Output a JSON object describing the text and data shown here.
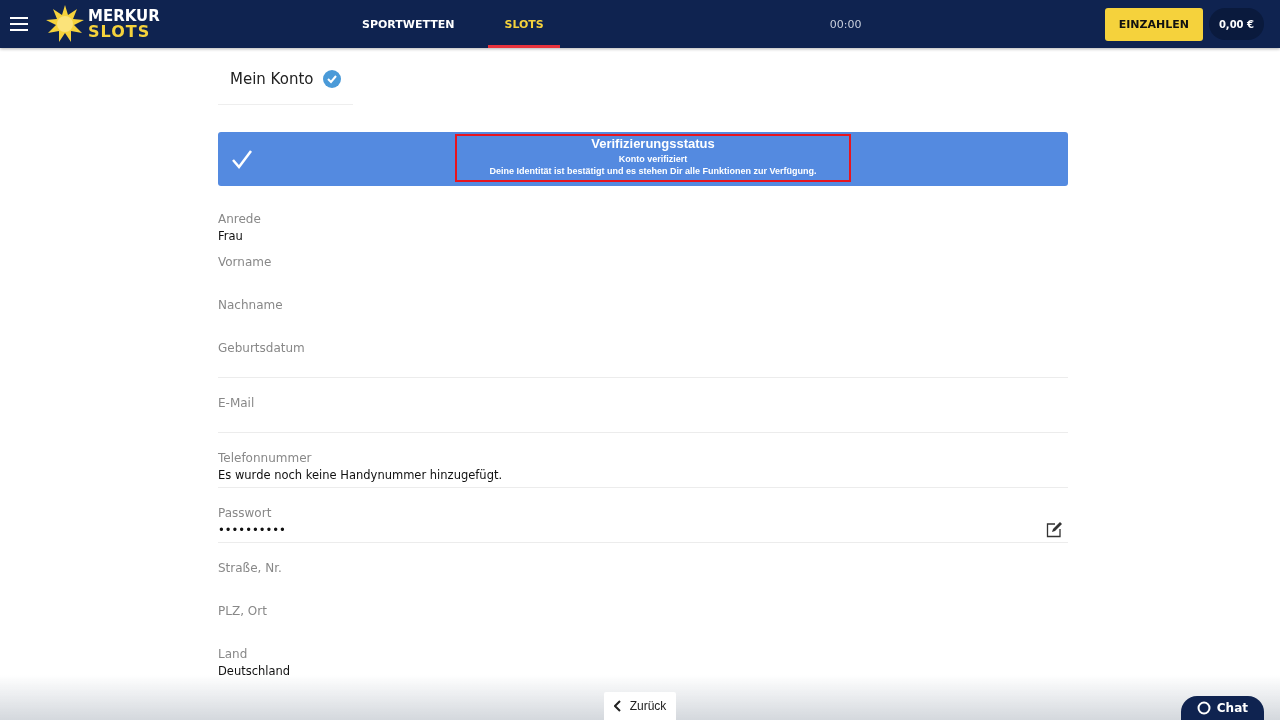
{
  "header": {
    "brand_top": "MERKUR",
    "brand_bottom": "SLOTS",
    "nav": [
      {
        "label": "SPORTWETTEN",
        "selected": false
      },
      {
        "label": "SLOTS",
        "selected": true
      }
    ],
    "timer": "00:00",
    "deposit_button": "EINZAHLEN",
    "balance": "0,00 €"
  },
  "page": {
    "title": "Mein Konto",
    "verified": true
  },
  "status_banner": {
    "title": "Verifizierungsstatus",
    "subtitle": "Konto verifiziert",
    "message": "Deine Identität ist bestätigt und es stehen Dir alle Funktionen zur Verfügung.",
    "highlighted": true
  },
  "fields": [
    {
      "label": "Anrede",
      "value": "Frau",
      "divider": false,
      "editable": false
    },
    {
      "label": "Vorname",
      "divider": false,
      "editable": false
    },
    {
      "label": "Nachname",
      "divider": false,
      "editable": false
    },
    {
      "label": "Geburtsdatum",
      "divider": true,
      "editable": false
    },
    {
      "label": "E-Mail",
      "divider": true,
      "editable": false
    },
    {
      "label": "Telefonnummer",
      "value": "Es wurde noch keine Handynummer hinzugefügt.",
      "divider": true,
      "editable": false
    },
    {
      "label": "Passwort",
      "value": "••••••••••",
      "divider": true,
      "editable": true
    },
    {
      "label": "Straße, Nr.",
      "divider": false,
      "editable": false
    },
    {
      "label": "PLZ, Ort",
      "divider": false,
      "editable": false
    },
    {
      "label": "Land",
      "value": "Deutschland",
      "divider": false,
      "editable": false
    }
  ],
  "footer": {
    "back_button": "Zurück",
    "chat_button": "Chat"
  }
}
